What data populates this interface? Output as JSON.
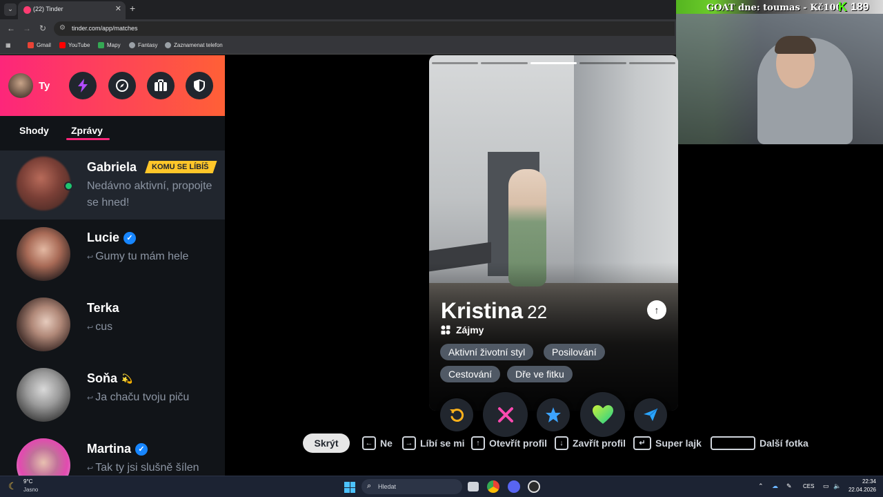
{
  "browser": {
    "tab_title": "(22) Tinder",
    "tab_close": "✕",
    "new_tab": "+",
    "url": "tinder.com/app/matches",
    "bookmarks": [
      {
        "label": "Gmail",
        "color": "#ea4335"
      },
      {
        "label": "YouTube",
        "color": "#ff0000"
      },
      {
        "label": "Mapy",
        "color": "#34a853"
      },
      {
        "label": "Fantasy",
        "color": "#9aa0a6"
      },
      {
        "label": "Zaznamenat telefon",
        "color": "#9aa0a6"
      }
    ]
  },
  "webcam": {
    "caption": "GOAT dne: toumas - Kč100",
    "k_logo": "K",
    "count": "189"
  },
  "sidebar": {
    "me_label": "Ty",
    "header_icons": [
      "lightning-icon",
      "compass-icon",
      "briefcase-icon",
      "shield-icon"
    ],
    "tabs": [
      "Shody",
      "Zprávy"
    ],
    "active_tab": "Zprávy",
    "matches": [
      {
        "name": "Gabriela",
        "badge": "KOMU SE LÍBÍŠ",
        "message": "Nedávno aktivní, propojte se hned!",
        "online": true,
        "verified": false
      },
      {
        "name": "Lucie",
        "message": "Gumy tu mám hele",
        "reply": true,
        "verified": true
      },
      {
        "name": "Terka",
        "message": "cus",
        "reply": true,
        "verified": false
      },
      {
        "name": "Soňa",
        "emoji": "💫",
        "message": "Ja chaču tvoju piču",
        "reply": true,
        "verified": false
      },
      {
        "name": "Martina",
        "message": "Tak ty jsi slušně šílen",
        "reply": true,
        "verified": true
      }
    ]
  },
  "profile": {
    "name": "Kristina",
    "age": "22",
    "photo_count": 5,
    "active_photo": 3,
    "interests_title": "Zájmy",
    "interests": [
      "Aktivní životní styl",
      "Posilování",
      "Cestování",
      "Dře ve fitku"
    ]
  },
  "actions": [
    "rewind-icon",
    "nope-icon",
    "super-like-icon",
    "like-icon",
    "boost-icon"
  ],
  "hints": {
    "hide": "Skrýt",
    "items": [
      {
        "key": "←",
        "label": "Ne"
      },
      {
        "key": "→",
        "label": "Líbí se mi"
      },
      {
        "key": "↑",
        "label": "Otevřít profil"
      },
      {
        "key": "↓",
        "label": "Zavřít profil"
      },
      {
        "key": "↵",
        "label": "Super lajk"
      },
      {
        "key": "",
        "label": "Další fotka"
      }
    ]
  },
  "taskbar": {
    "weather_temp": "9°C",
    "weather_desc": "Jasno",
    "search_placeholder": "Hledat",
    "language": "CES",
    "time": "22:34",
    "date": "22.04.2026"
  },
  "colors": {
    "tinder_gradient_start": "#fd267a",
    "tinder_gradient_end": "#ff6036",
    "badge_yellow": "#ffc629",
    "online_green": "#1ec66f",
    "verified_blue": "#1786ff"
  }
}
